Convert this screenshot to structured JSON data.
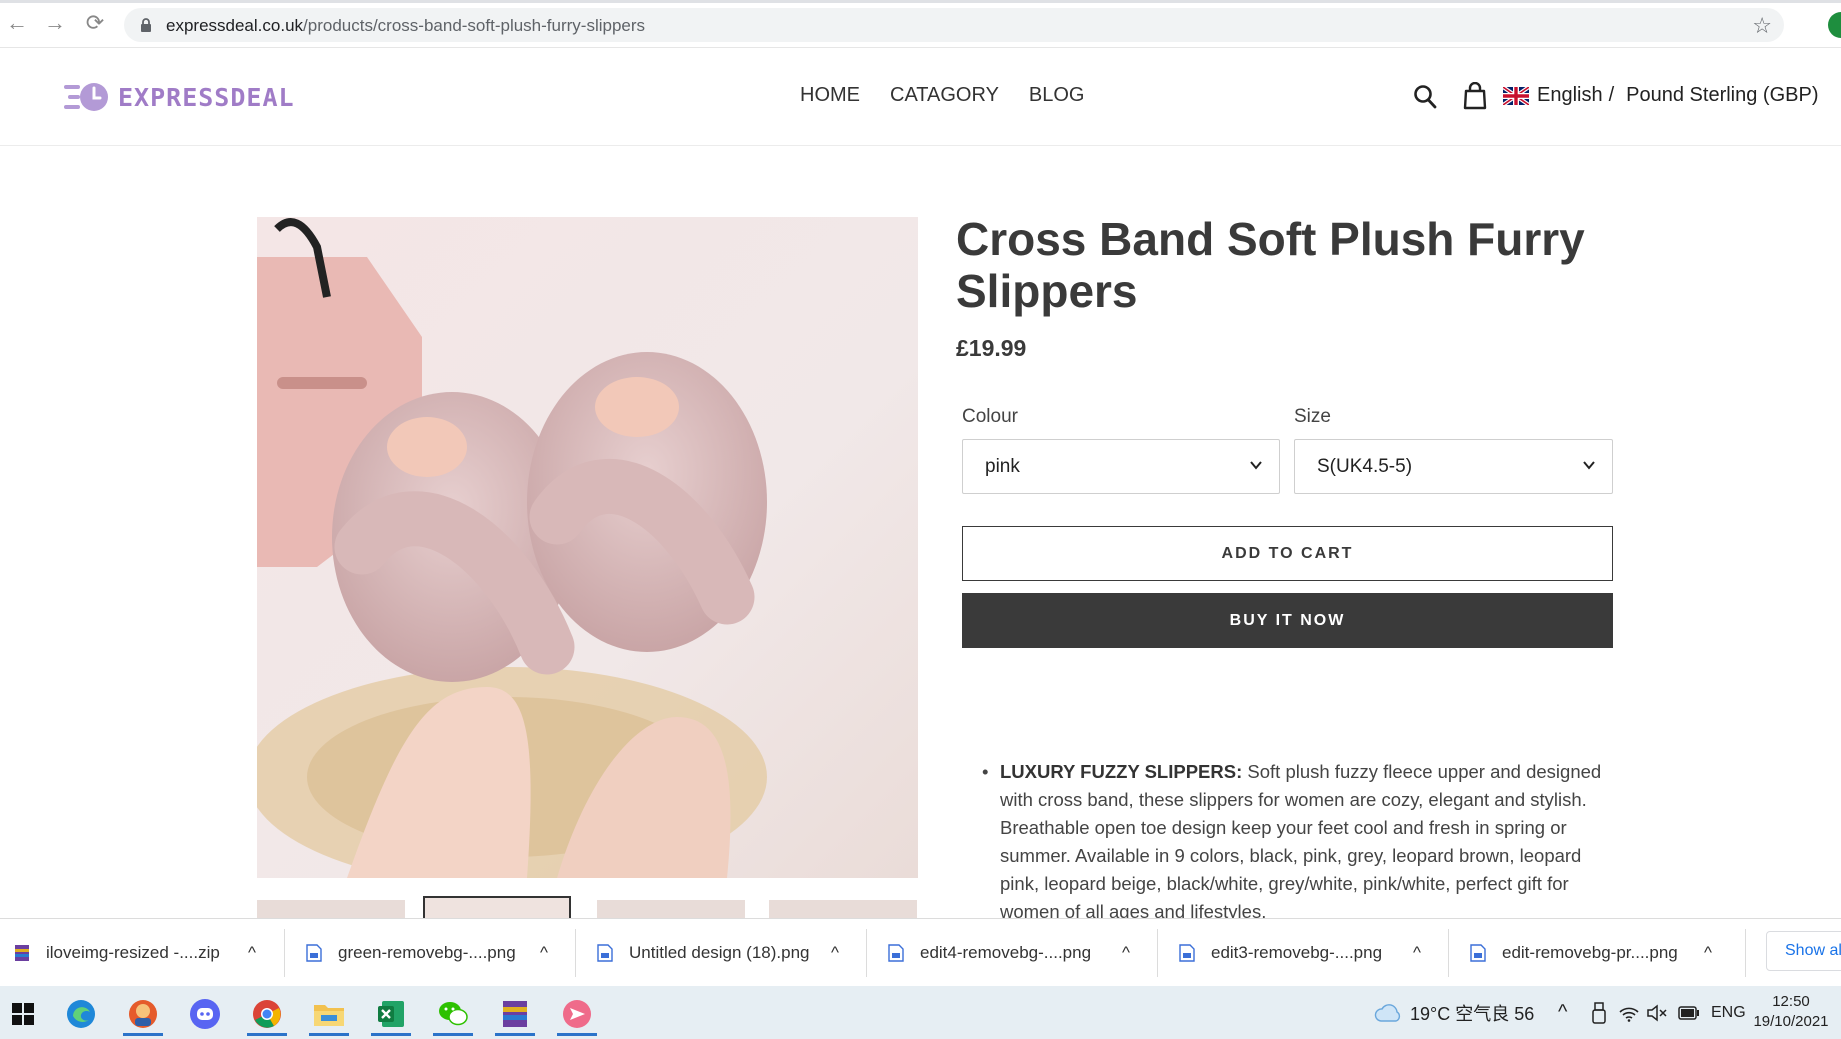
{
  "browser": {
    "url_host": "expressdeal.co.uk",
    "url_path": "/products/cross-band-soft-plush-furry-slippers"
  },
  "header": {
    "logo_text": "EXPRESSDEAL",
    "nav": [
      "HOME",
      "CATAGORY",
      "BLOG"
    ],
    "language": "English",
    "separator": "/",
    "currency": "Pound Sterling (GBP)"
  },
  "product": {
    "title": "Cross Band Soft Plush Furry Slippers",
    "price": "£19.99",
    "colour_label": "Colour",
    "colour_value": "pink",
    "size_label": "Size",
    "size_value": "S(UK4.5-5)",
    "add_to_cart": "ADD TO CART",
    "buy_now": "BUY IT NOW",
    "description_bold": "LUXURY FUZZY SLIPPERS:",
    "description_text": " Soft plush fuzzy fleece upper and designed with cross band, these slippers for women are cozy, elegant and stylish. Breathable open toe design keep your feet cool and fresh in spring or summer. Available in 9 colors, black, pink, grey, leopard brown, leopard pink, leopard beige, black/white, grey/white, pink/white, perfect gift for women of all ages and lifestyles."
  },
  "downloads": {
    "items": [
      "iloveimg-resized -....zip",
      "green-removebg-....png",
      "Untitled design (18).png",
      "edit4-removebg-....png",
      "edit3-removebg-....png",
      "edit-removebg-pr....png"
    ],
    "show_all": "Show all"
  },
  "taskbar": {
    "weather": "19°C 空气良 56",
    "lang": "ENG",
    "time": "12:50",
    "date": "19/10/2021"
  },
  "colors": {
    "brand": "#a07cc7",
    "dark_button": "#3a3a3a",
    "taskbar": "#e6eef3"
  }
}
